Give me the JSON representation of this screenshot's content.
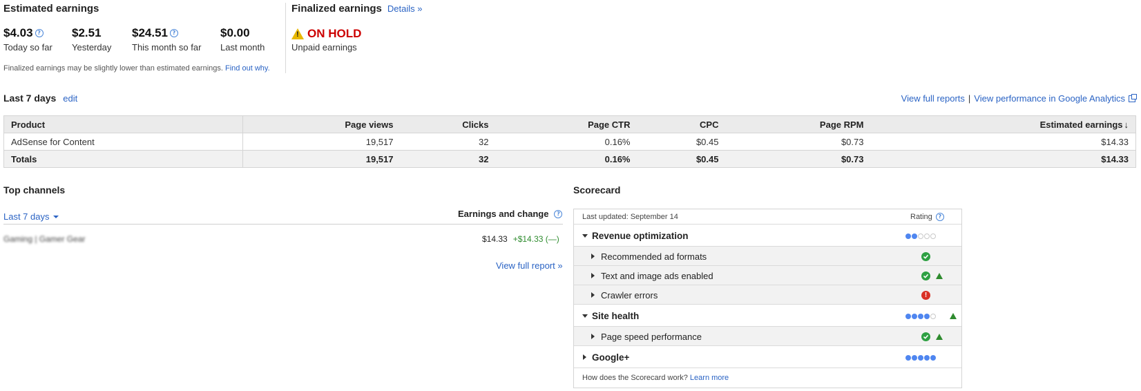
{
  "estimated": {
    "title": "Estimated earnings",
    "metrics": [
      {
        "value": "$4.03",
        "label": "Today so far"
      },
      {
        "value": "$2.51",
        "label": "Yesterday"
      },
      {
        "value": "$24.51",
        "label": "This month so far"
      },
      {
        "value": "$0.00",
        "label": "Last month"
      }
    ],
    "note": "Finalized earnings may be slightly lower than estimated earnings.",
    "note_link": "Find out why."
  },
  "finalized": {
    "title": "Finalized earnings",
    "details_link": "Details »",
    "status": "ON HOLD",
    "status_label": "Unpaid earnings"
  },
  "last7": {
    "title": "Last 7 days",
    "edit_link": "edit",
    "full_reports_link": "View full reports",
    "separator": "|",
    "analytics_link": "View performance in Google Analytics"
  },
  "table": {
    "headers": [
      "Product",
      "Page views",
      "Clicks",
      "Page CTR",
      "CPC",
      "Page RPM",
      "Estimated earnings"
    ],
    "rows": [
      [
        "AdSense for Content",
        "19,517",
        "32",
        "0.16%",
        "$0.45",
        "$0.73",
        "$14.33"
      ]
    ],
    "totals": [
      "Totals",
      "19,517",
      "32",
      "0.16%",
      "$0.45",
      "$0.73",
      "$14.33"
    ]
  },
  "top_channels": {
    "title": "Top channels",
    "range": "Last 7 days",
    "col_header": "Earnings and change",
    "channel_name": "Gaming | Gamer Gear",
    "earnings": "$14.33",
    "change": "+$14.33 (—)",
    "full_report_link": "View full report »"
  },
  "scorecard": {
    "title": "Scorecard",
    "updated": "Last updated: September 14",
    "rating_header": "Rating",
    "categories": [
      {
        "name": "Revenue optimization",
        "rating_filled": 2,
        "rating_total": 5,
        "trend_up": false
      },
      {
        "name": "Site health",
        "rating_filled": 4,
        "rating_total": 5,
        "trend_up": true
      },
      {
        "name": "Google+",
        "rating_filled": 5,
        "rating_total": 5,
        "trend_up": false
      }
    ],
    "items": [
      {
        "name": "Recommended ad formats",
        "status": "ok",
        "trend_up": false
      },
      {
        "name": "Text and image ads enabled",
        "status": "ok",
        "trend_up": true
      },
      {
        "name": "Crawler errors",
        "status": "error",
        "trend_up": false
      },
      {
        "name": "Page speed performance",
        "status": "ok",
        "trend_up": true
      }
    ],
    "footer": "How does the Scorecard work?",
    "footer_link": "Learn more"
  },
  "colors": {
    "link": "#2a63c4",
    "on_hold": "#cc0000",
    "positive": "#2e8b2e",
    "rating_dot": "#4f86f0"
  }
}
